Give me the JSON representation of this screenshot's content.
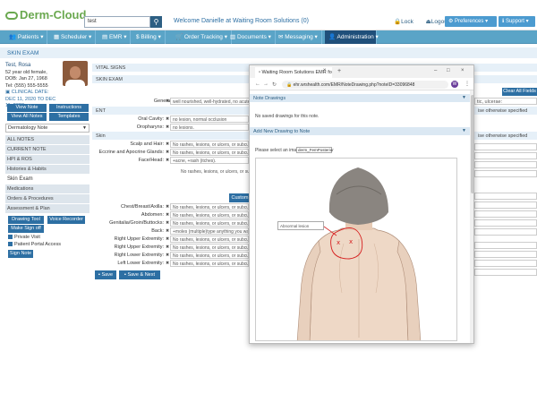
{
  "app": {
    "logo": "Derm-Cloud"
  },
  "search": {
    "value": "test"
  },
  "welcome": "Welcome Danielle at Waiting Room Solutions (0)",
  "top_links": {
    "lock": "Lock",
    "logout": "Logout",
    "preferences": "Preferences",
    "support": "Support"
  },
  "nav": [
    {
      "label": "Patients"
    },
    {
      "label": "Scheduler"
    },
    {
      "label": "EMR"
    },
    {
      "label": "Billing"
    },
    {
      "label": "Order Tracking"
    },
    {
      "label": "Documents"
    },
    {
      "label": "Messaging"
    },
    {
      "label": "Administration"
    }
  ],
  "page_title": "SKIN EXAM",
  "patient": {
    "name": "Test, Rosa",
    "age_sex": "52 year old female,",
    "dob": "DOB: Jan 27, 1968",
    "tel": "Tel: (555) 555-5555",
    "clinical_label": "CLINICAL DATE:",
    "clinical_range": "DEC 11, 2020 TO DEC 11, 2020"
  },
  "sidebar": {
    "view_note": "View Note",
    "instructions": "Instructions",
    "view_all_notes": "View All Notes",
    "templates": "Templates",
    "note_type": "Dermatology Note",
    "sections": [
      "ALL NOTES",
      "CURRENT NOTE",
      "HPI & ROS",
      "Histories & Habits",
      "Skin Exam",
      "Medications",
      "Orders & Procedures",
      "Assessment & Plan"
    ],
    "drawing_tool": "Drawing Tool",
    "voice_recorder": "Voice Recorder",
    "make_sign_off": "Make Sign off",
    "private_visit": "Private Visit",
    "patient_portal": "Patient Portal Access",
    "sign_note": "Sign Note"
  },
  "main": {
    "vital_signs": "VITAL SIGNS",
    "skin_exam": "SKIN EXAM",
    "ent": "ENT",
    "skin": "Skin",
    "general_label": "General:",
    "general_value": "well nourished, well-hydrated, no acute",
    "oral_cavity_label": "Oral Cavity:",
    "oral_cavity_value": "no lesion, normal occlusion",
    "oropharynx_label": "Oropharynx:",
    "oropharynx_value": "no lesions.",
    "scalp_label": "Scalp and Hair:",
    "scalp_value": "No rashes, lesions, or ulcers, or subcuta",
    "eccrine_label": "Eccrine and Apocrine Glands:",
    "eccrine_value": "No rashes, lesions, or ulcers, or subcuta",
    "face_label": "Face/Head:",
    "face_value": "+acne, +rash (itches).",
    "extra_value": "No rashes, lesions, or ulcers, or subcuta",
    "custom_btn": "Custom",
    "chest_label": "Chest/Breast/Axilla:",
    "chest_value": "No rashes, lesions, or ulcers, or subcuta",
    "abdomen_label": "Abdomen:",
    "abdomen_value": "No rashes, lesions, or ulcers, or subcuta",
    "genitalia_label": "Genitalia/Groin/Buttocks:",
    "genitalia_value": "No rashes, lesions, or ulcers, or subcuta",
    "back_label": "Back:",
    "back_value": "+moles (multiple)type anything you want",
    "rue_label": "Right Upper Extremity:",
    "rue_value": "No rashes, lesions, or ulcers, or subcuta",
    "lue_label": "Right Upper Extremity:",
    "lue_value": "No rashes, lesions, or ulcers, or subcuta",
    "rle_label": "Right Lower Extremity:",
    "rle_value": "No rashes, lesions, or ulcers, or subcuta",
    "lle_label": "Left Lower Extremity:",
    "lle_value": "No rashes, lesions, or ulcers, or subcuta",
    "save": "Save",
    "save_next": "Save & Next",
    "clear_all": "Clear All Fields",
    "right_text1": "tic, ulcerae:",
    "right_text2": "ise otherwise specified",
    "right_text3": "ise otherwise specified"
  },
  "popup": {
    "tab_title": "Waiting Room Solutions EMR fo",
    "url": "ehr.wrshealth.com/EMR/NoteDrawing.php?noteID=33096848",
    "profile_initial": "W",
    "note_drawings": "Note Drawings",
    "no_drawings": "No saved drawings for this note.",
    "add_new_drawing": "Add New Drawing to Note",
    "select_image": "Please select an image:",
    "image_choice": "derm_FemPosterior",
    "abnormal_lesion": "Abnormal lesion"
  },
  "colors": {
    "nav_bg": "#5aa4c7",
    "nav_active": "#1f4f7a",
    "button_blue": "#2d6fa3",
    "annotation_red": "#d62020"
  }
}
